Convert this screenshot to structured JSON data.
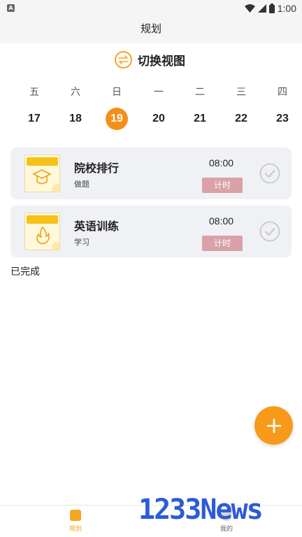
{
  "status_bar": {
    "time": "1:00"
  },
  "header": {
    "title": "规划"
  },
  "switch_view": {
    "label": "切换视图"
  },
  "week": [
    {
      "weekday": "五",
      "date": "17",
      "selected": false
    },
    {
      "weekday": "六",
      "date": "18",
      "selected": false
    },
    {
      "weekday": "日",
      "date": "19",
      "selected": true
    },
    {
      "weekday": "一",
      "date": "20",
      "selected": false
    },
    {
      "weekday": "二",
      "date": "21",
      "selected": false
    },
    {
      "weekday": "三",
      "date": "22",
      "selected": false
    },
    {
      "weekday": "四",
      "date": "23",
      "selected": false
    }
  ],
  "tasks": [
    {
      "title": "院校排行",
      "subtitle": "做题",
      "time": "08:00",
      "timer_label": "计时",
      "icon": "graduation-cap-icon"
    },
    {
      "title": "英语训练",
      "subtitle": "学习",
      "time": "08:00",
      "timer_label": "计时",
      "icon": "flame-icon"
    }
  ],
  "completed": {
    "label": "已完成"
  },
  "fab": {
    "icon": "plus-icon"
  },
  "tabbar": {
    "items": [
      {
        "label": "规划",
        "active": true,
        "icon": "plan-icon"
      },
      {
        "label": "我的",
        "active": false,
        "icon": "profile-icon"
      }
    ]
  },
  "watermark": {
    "text": "1233News"
  },
  "colors": {
    "accent": "#f58f1a",
    "timer_button": "#d9a2a8",
    "card_bg": "#f0f1f5"
  }
}
